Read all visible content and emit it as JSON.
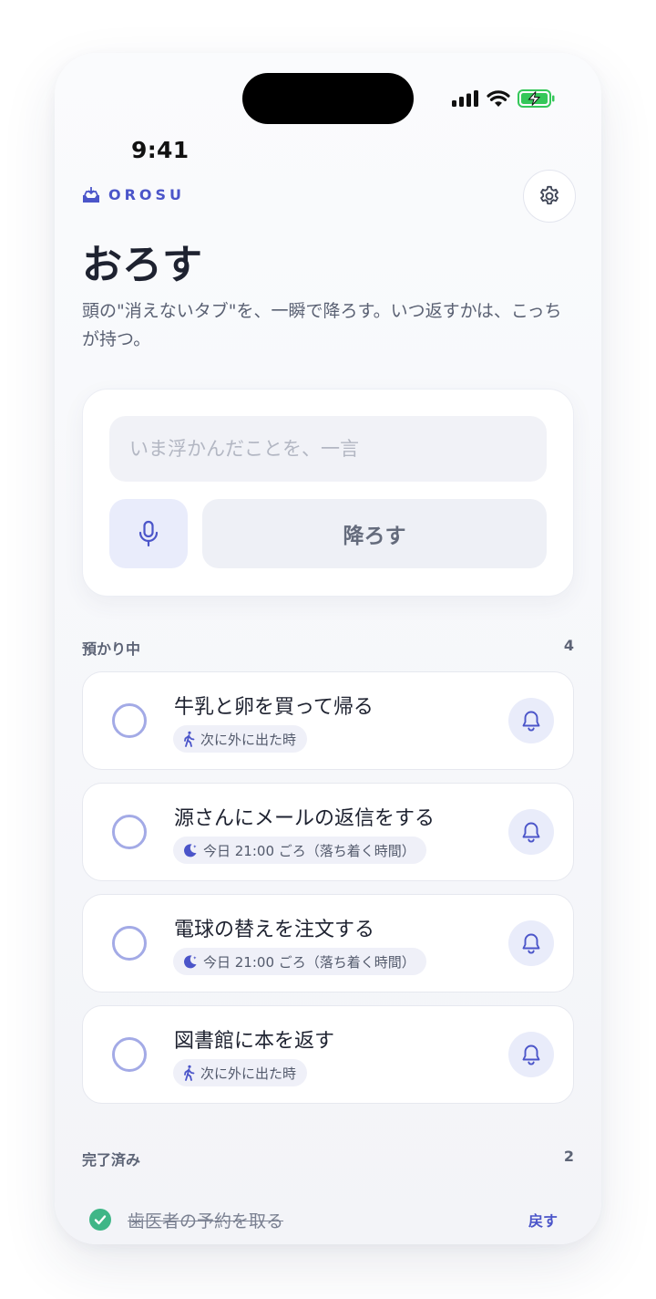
{
  "status_bar": {
    "time": "9:41"
  },
  "brand": {
    "name": "OROSU",
    "icon": "inbox-tray-icon"
  },
  "header": {
    "title": "おろす",
    "subtitle": "頭の\"消えないタブ\"を、一瞬で降ろす。いつ返すかは、こっちが持つ。"
  },
  "composer": {
    "placeholder": "いま浮かんだことを、一言",
    "value": "",
    "submit_label": "降ろす",
    "mic_icon": "microphone-icon"
  },
  "active_section": {
    "label": "預かり中",
    "count": "4",
    "tasks": [
      {
        "title": "牛乳と卵を買って帰る",
        "when_icon": "walking-icon",
        "when": "次に外に出た時"
      },
      {
        "title": "源さんにメールの返信をする",
        "when_icon": "moon-icon",
        "when": "今日 21:00 ごろ（落ち着く時間）"
      },
      {
        "title": "電球の替えを注文する",
        "when_icon": "moon-icon",
        "when": "今日 21:00 ごろ（落ち着く時間）"
      },
      {
        "title": "図書館に本を返す",
        "when_icon": "walking-icon",
        "when": "次に外に出た時"
      }
    ]
  },
  "done_section": {
    "label": "完了済み",
    "count": "2",
    "items": [
      {
        "title": "歯医者の予約を取る",
        "undo_label": "戻す"
      }
    ]
  },
  "colors": {
    "accent": "#4b55c9",
    "done_green": "#3fb687",
    "battery_green": "#34c759"
  }
}
